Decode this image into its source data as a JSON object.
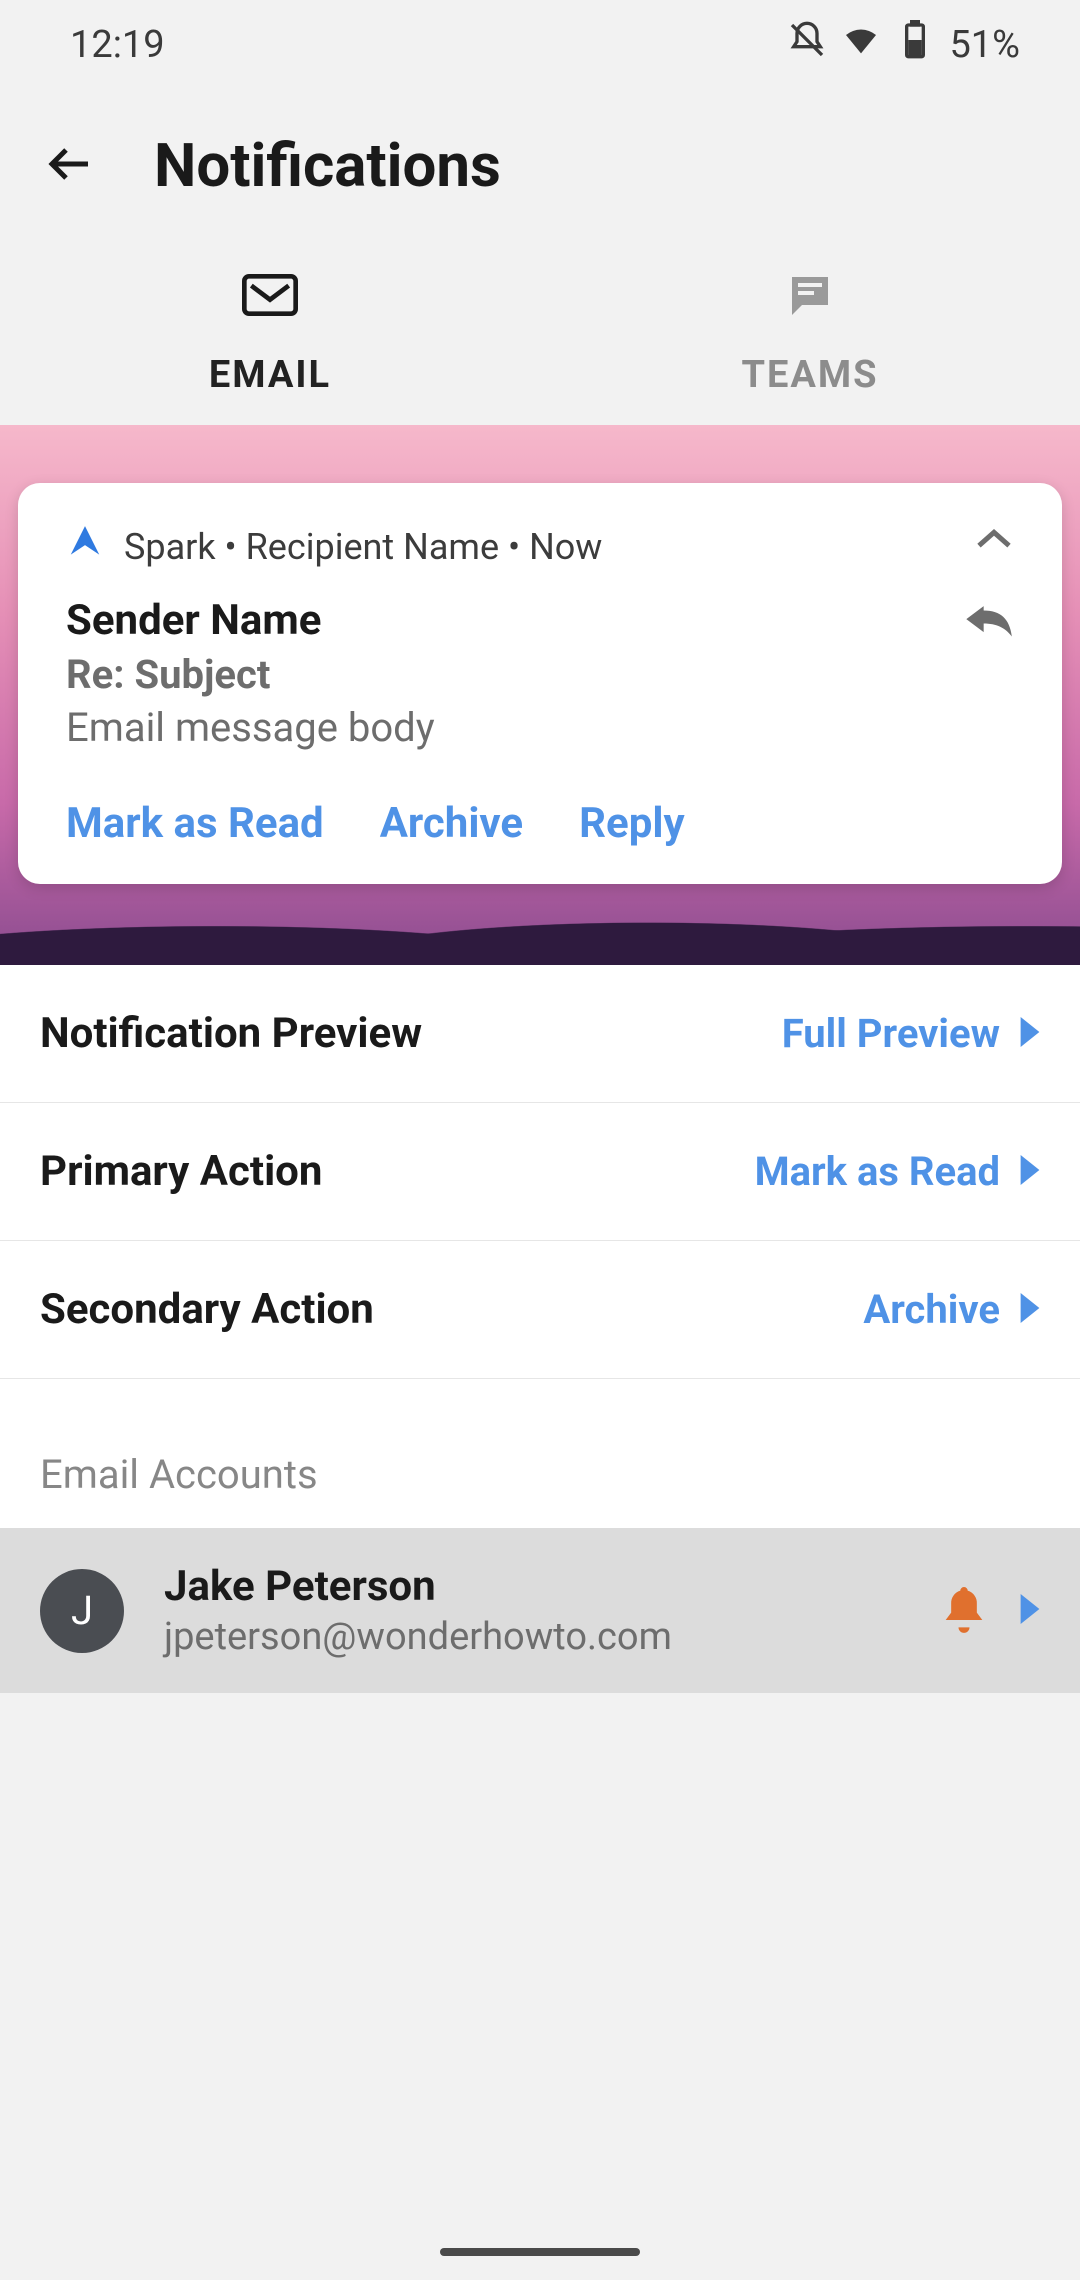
{
  "statusbar": {
    "time": "12:19",
    "battery": "51%"
  },
  "header": {
    "title": "Notifications"
  },
  "tabs": {
    "email": "EMAIL",
    "teams": "TEAMS"
  },
  "notification_card": {
    "meta": "Spark • Recipient Name • Now",
    "sender": "Sender Name",
    "subject": "Re: Subject",
    "body": "Email message body",
    "actions": {
      "mark_read": "Mark as Read",
      "archive": "Archive",
      "reply": "Reply"
    }
  },
  "settings": [
    {
      "label": "Notification Preview",
      "value": "Full Preview"
    },
    {
      "label": "Primary Action",
      "value": "Mark as Read"
    },
    {
      "label": "Secondary Action",
      "value": "Archive"
    }
  ],
  "section": {
    "email_accounts": "Email Accounts"
  },
  "account": {
    "initial": "J",
    "name": "Jake Peterson",
    "email": "jpeterson@wonderhowto.com"
  }
}
